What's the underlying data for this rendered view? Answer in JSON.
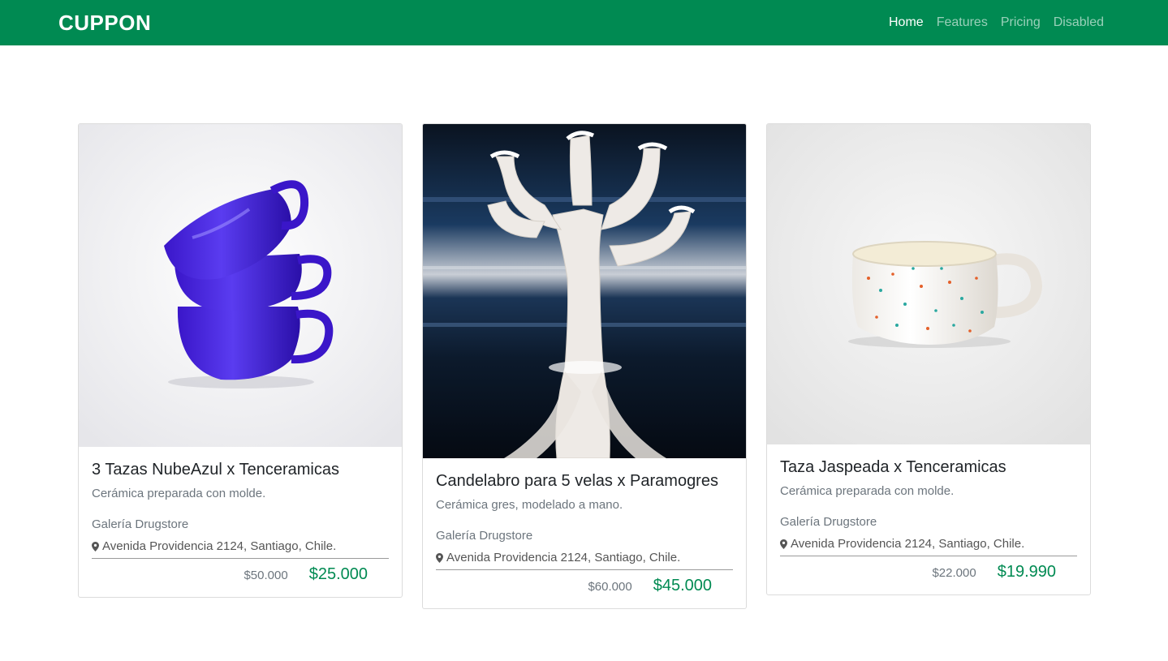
{
  "brand": "CUPPON",
  "nav": [
    {
      "label": "Home",
      "active": true
    },
    {
      "label": "Features",
      "active": false
    },
    {
      "label": "Pricing",
      "active": false
    },
    {
      "label": "Disabled",
      "active": false
    }
  ],
  "cards": [
    {
      "title": "3 Tazas NubeAzul x Tenceramicas",
      "description": "Cerámica preparada con molde.",
      "venue": "Galería Drugstore",
      "address": "Avenida Providencia 2124, Santiago, Chile.",
      "old_price": "$50.000",
      "new_price": "$25.000"
    },
    {
      "title": "Candelabro para 5 velas x Paramogres",
      "description": "Cerámica gres, modelado a mano.",
      "venue": "Galería Drugstore",
      "address": "Avenida Providencia 2124, Santiago, Chile.",
      "old_price": "$60.000",
      "new_price": "$45.000"
    },
    {
      "title": "Taza Jaspeada x Tenceramicas",
      "description": "Cerámica preparada con molde.",
      "venue": "Galería Drugstore",
      "address": "Avenida Providencia 2124, Santiago, Chile.",
      "old_price": "$22.000",
      "new_price": "$19.990"
    }
  ],
  "icons": {
    "location": "map-marker-icon"
  },
  "colors": {
    "navbar": "#008a52",
    "price": "#008a52"
  }
}
